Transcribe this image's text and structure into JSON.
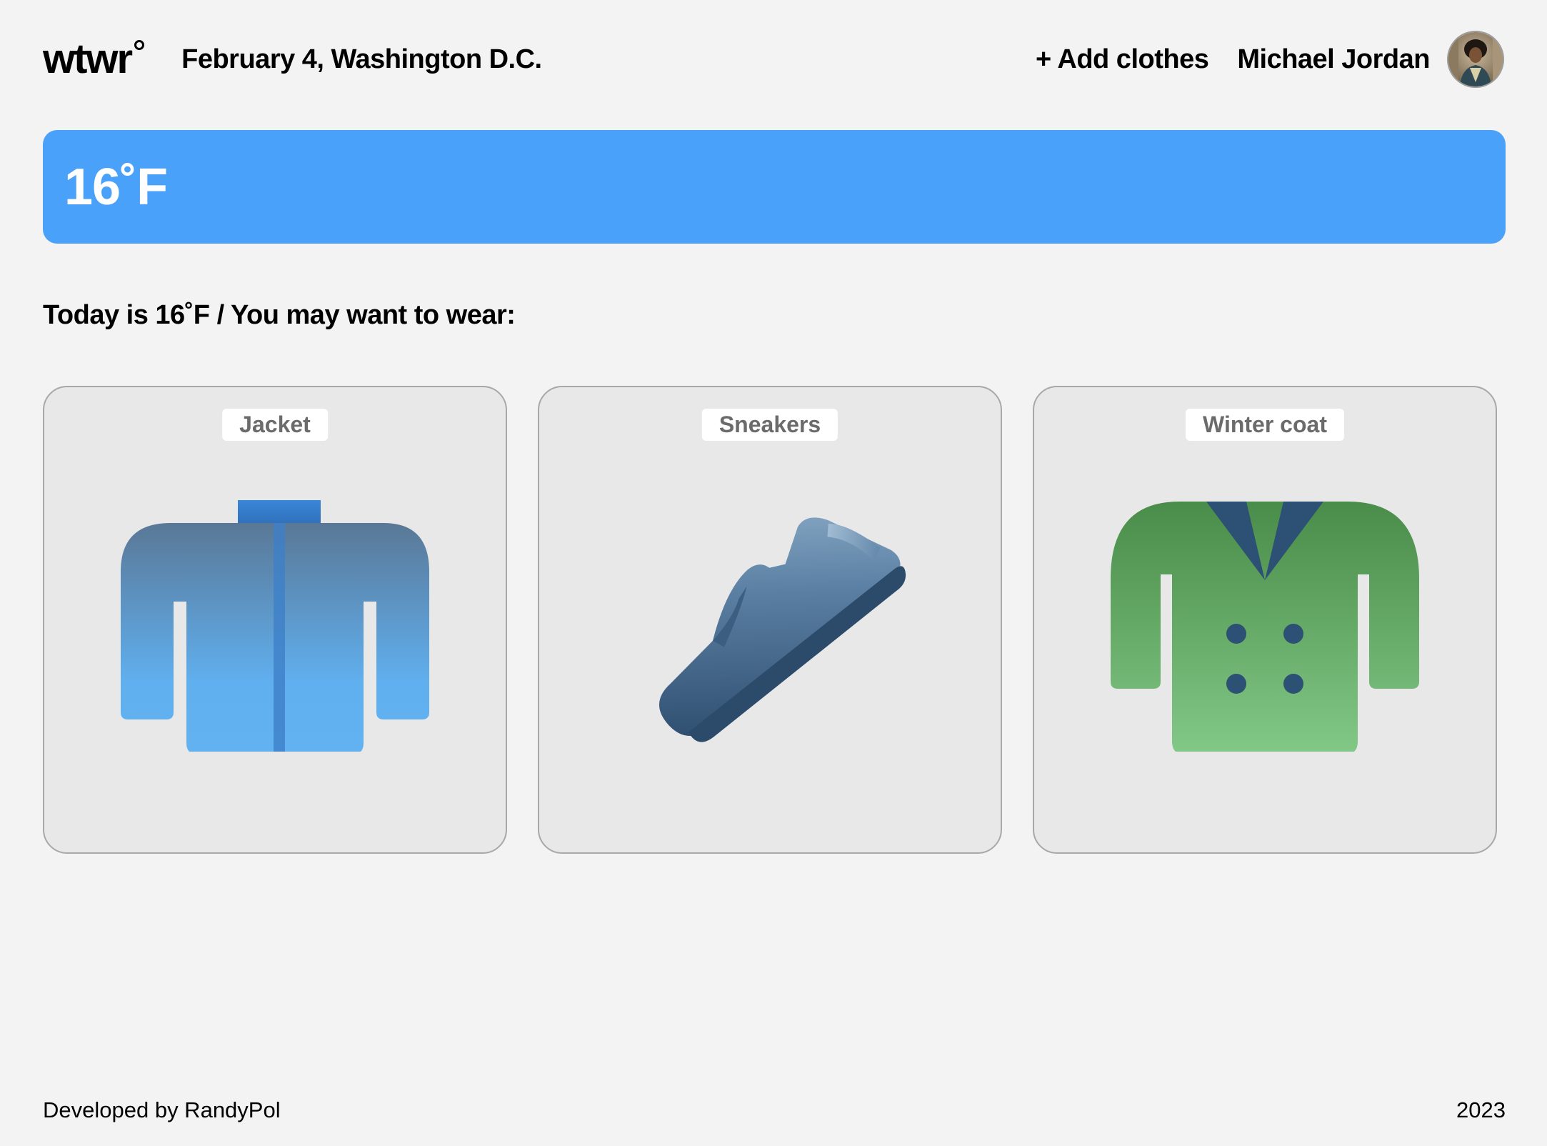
{
  "header": {
    "logo": "wtwr",
    "date_location": "February 4, Washington D.C.",
    "add_clothes": "+ Add clothes",
    "user_name": "Michael Jordan",
    "avatar_icon": "user-avatar-photo"
  },
  "weather": {
    "temperature": "16˚F",
    "banner_color": "#4aa1f9"
  },
  "recommendation": {
    "text": "Today is 16˚F / You may want to wear:"
  },
  "clothes": [
    {
      "name": "Jacket",
      "icon": "jacket-icon"
    },
    {
      "name": "Sneakers",
      "icon": "sneaker-icon"
    },
    {
      "name": "Winter coat",
      "icon": "winter-coat-icon"
    }
  ],
  "footer": {
    "developer": "Developed by RandyPol",
    "year": "2023"
  }
}
